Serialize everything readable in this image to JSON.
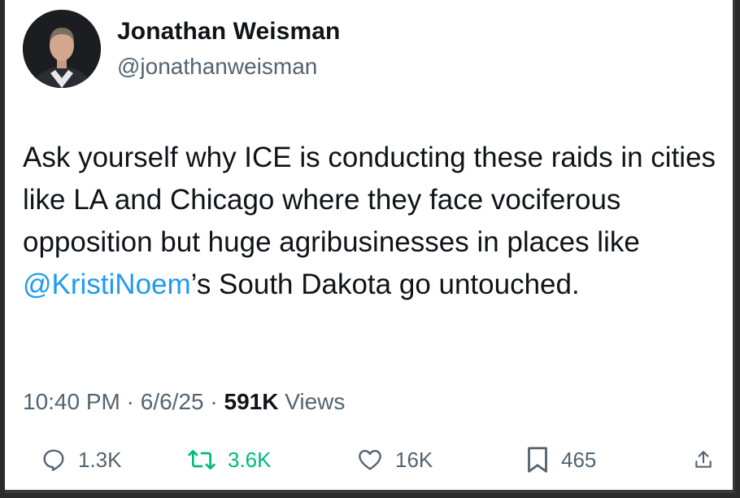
{
  "author": {
    "display_name": "Jonathan Weisman",
    "handle": "@jonathanweisman",
    "avatar_icon": "profile-photo"
  },
  "tweet": {
    "text_before": "Ask yourself why ICE is conducting these raids in cities like LA and Chicago where they face vociferous opposition but huge agribusinesses in places like ",
    "mention": "@KristiNoem",
    "text_after": "’s South Dakota go untouched."
  },
  "meta": {
    "time": "10:40 PM",
    "separator": " · ",
    "date": "6/6/25",
    "views_count": "591K",
    "views_label": " Views"
  },
  "actions": {
    "replies": "1.3K",
    "reposts": "3.6K",
    "likes": "16K",
    "bookmarks": "465"
  },
  "colors": {
    "text": "#0f1419",
    "secondary": "#536471",
    "mention": "#1d9bf0",
    "repost": "#00ba7c"
  }
}
